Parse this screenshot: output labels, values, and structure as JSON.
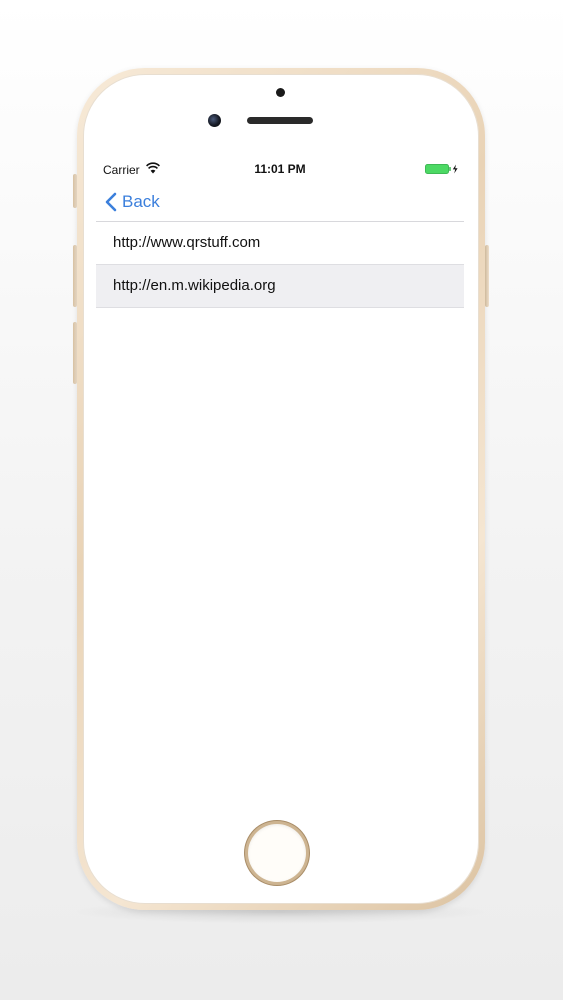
{
  "status_bar": {
    "carrier": "Carrier",
    "time": "11:01 PM",
    "wifi_icon": "wifi-icon",
    "battery_icon": "battery-charging-icon",
    "battery_color": "#4cd964"
  },
  "nav": {
    "back_label": "Back",
    "back_icon": "chevron-left-icon",
    "accent_color": "#3b7fdc"
  },
  "list": {
    "items": [
      {
        "label": "http://www.qrstuff.com",
        "selected": false
      },
      {
        "label": "http://en.m.wikipedia.org",
        "selected": true
      }
    ]
  }
}
